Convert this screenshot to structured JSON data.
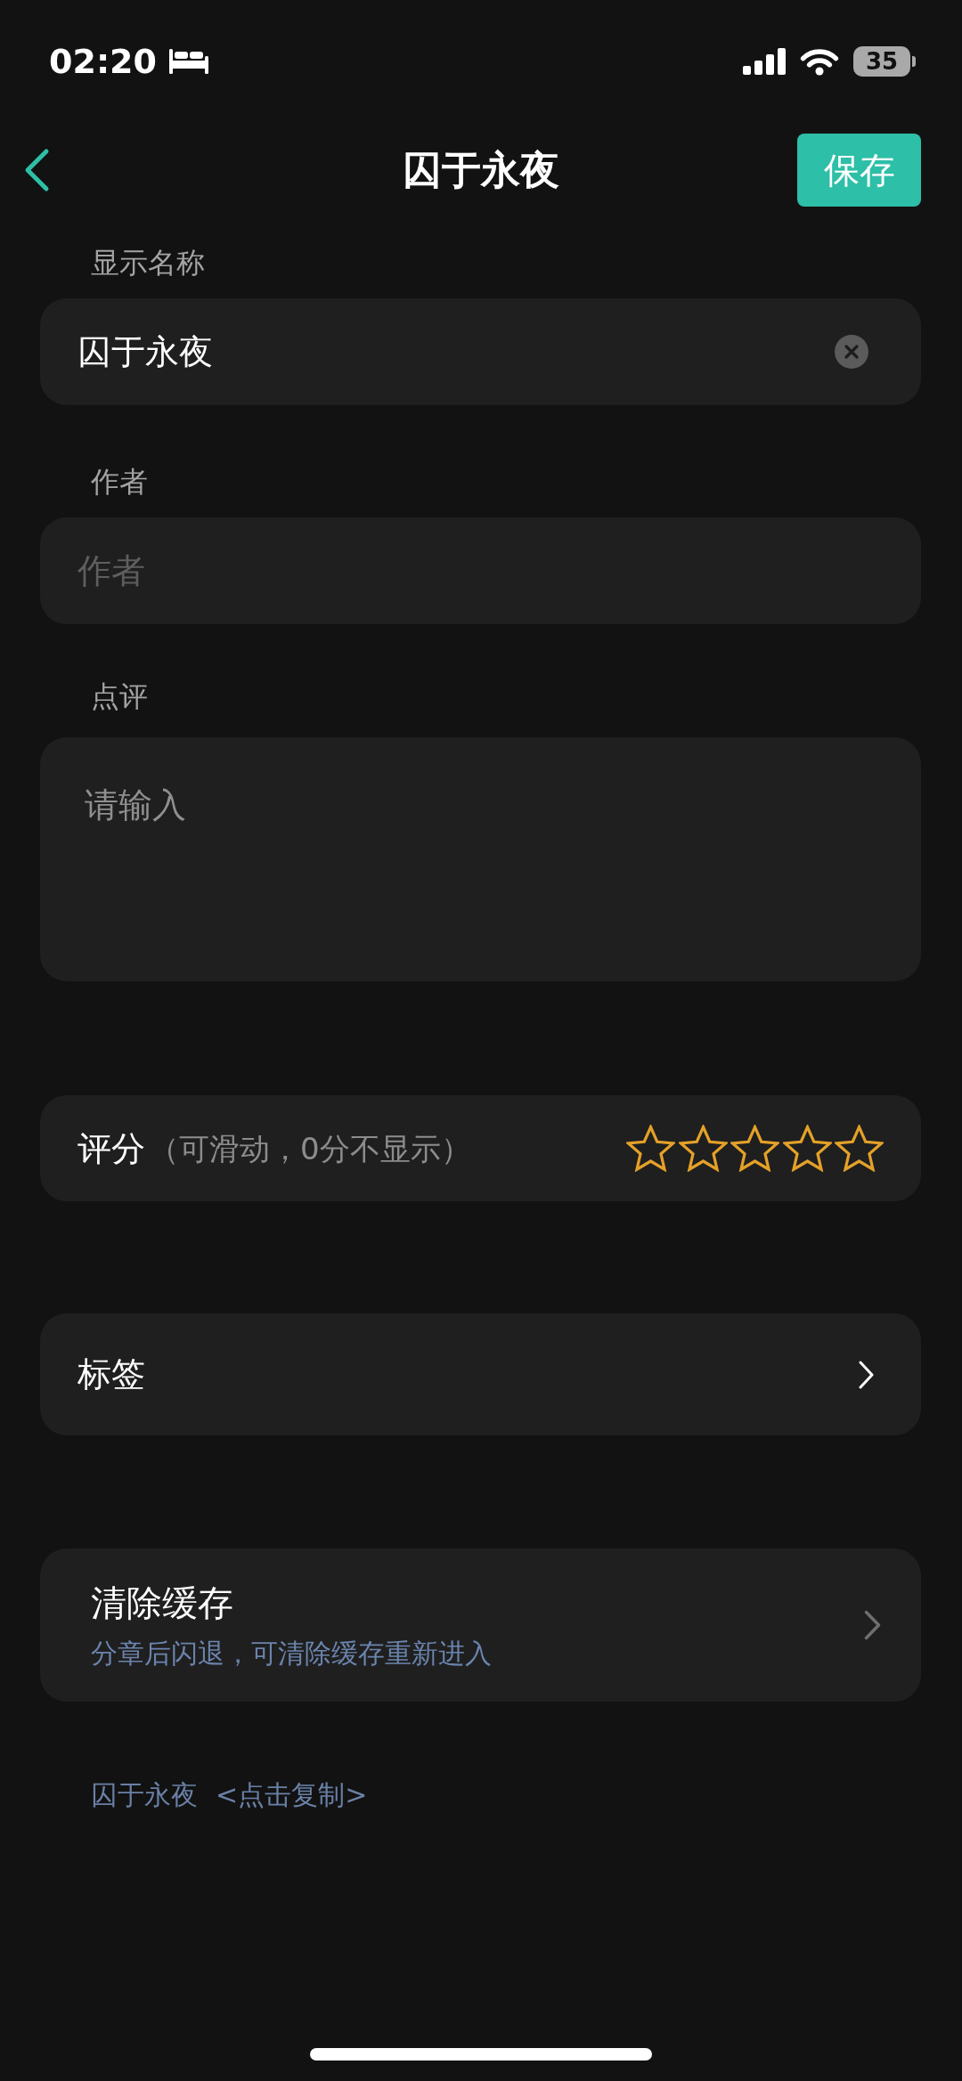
{
  "status_bar": {
    "time": "02:20",
    "battery": "35"
  },
  "header": {
    "title": "囚于永夜",
    "save_button": "保存"
  },
  "fields": [
    {
      "label": "显示名称",
      "kind": "input",
      "value": "囚于永夜",
      "clearable": true
    },
    {
      "label": "作者",
      "kind": "input",
      "placeholder": "作者",
      "clearable": false
    },
    {
      "label": "点评",
      "kind": "textarea",
      "placeholder": "请输入",
      "clearable": false
    }
  ],
  "rating": {
    "label": "评分",
    "hint": "（可滑动，0分不显示）",
    "stars": 0
  },
  "tags": {
    "label": "标签"
  },
  "clear_cache": {
    "title": "清除缓存",
    "description": "分章后闪退，可清除缓存重新进入"
  },
  "footer": {
    "title": "囚于永夜",
    "copy_link": "<点击复制>"
  }
}
